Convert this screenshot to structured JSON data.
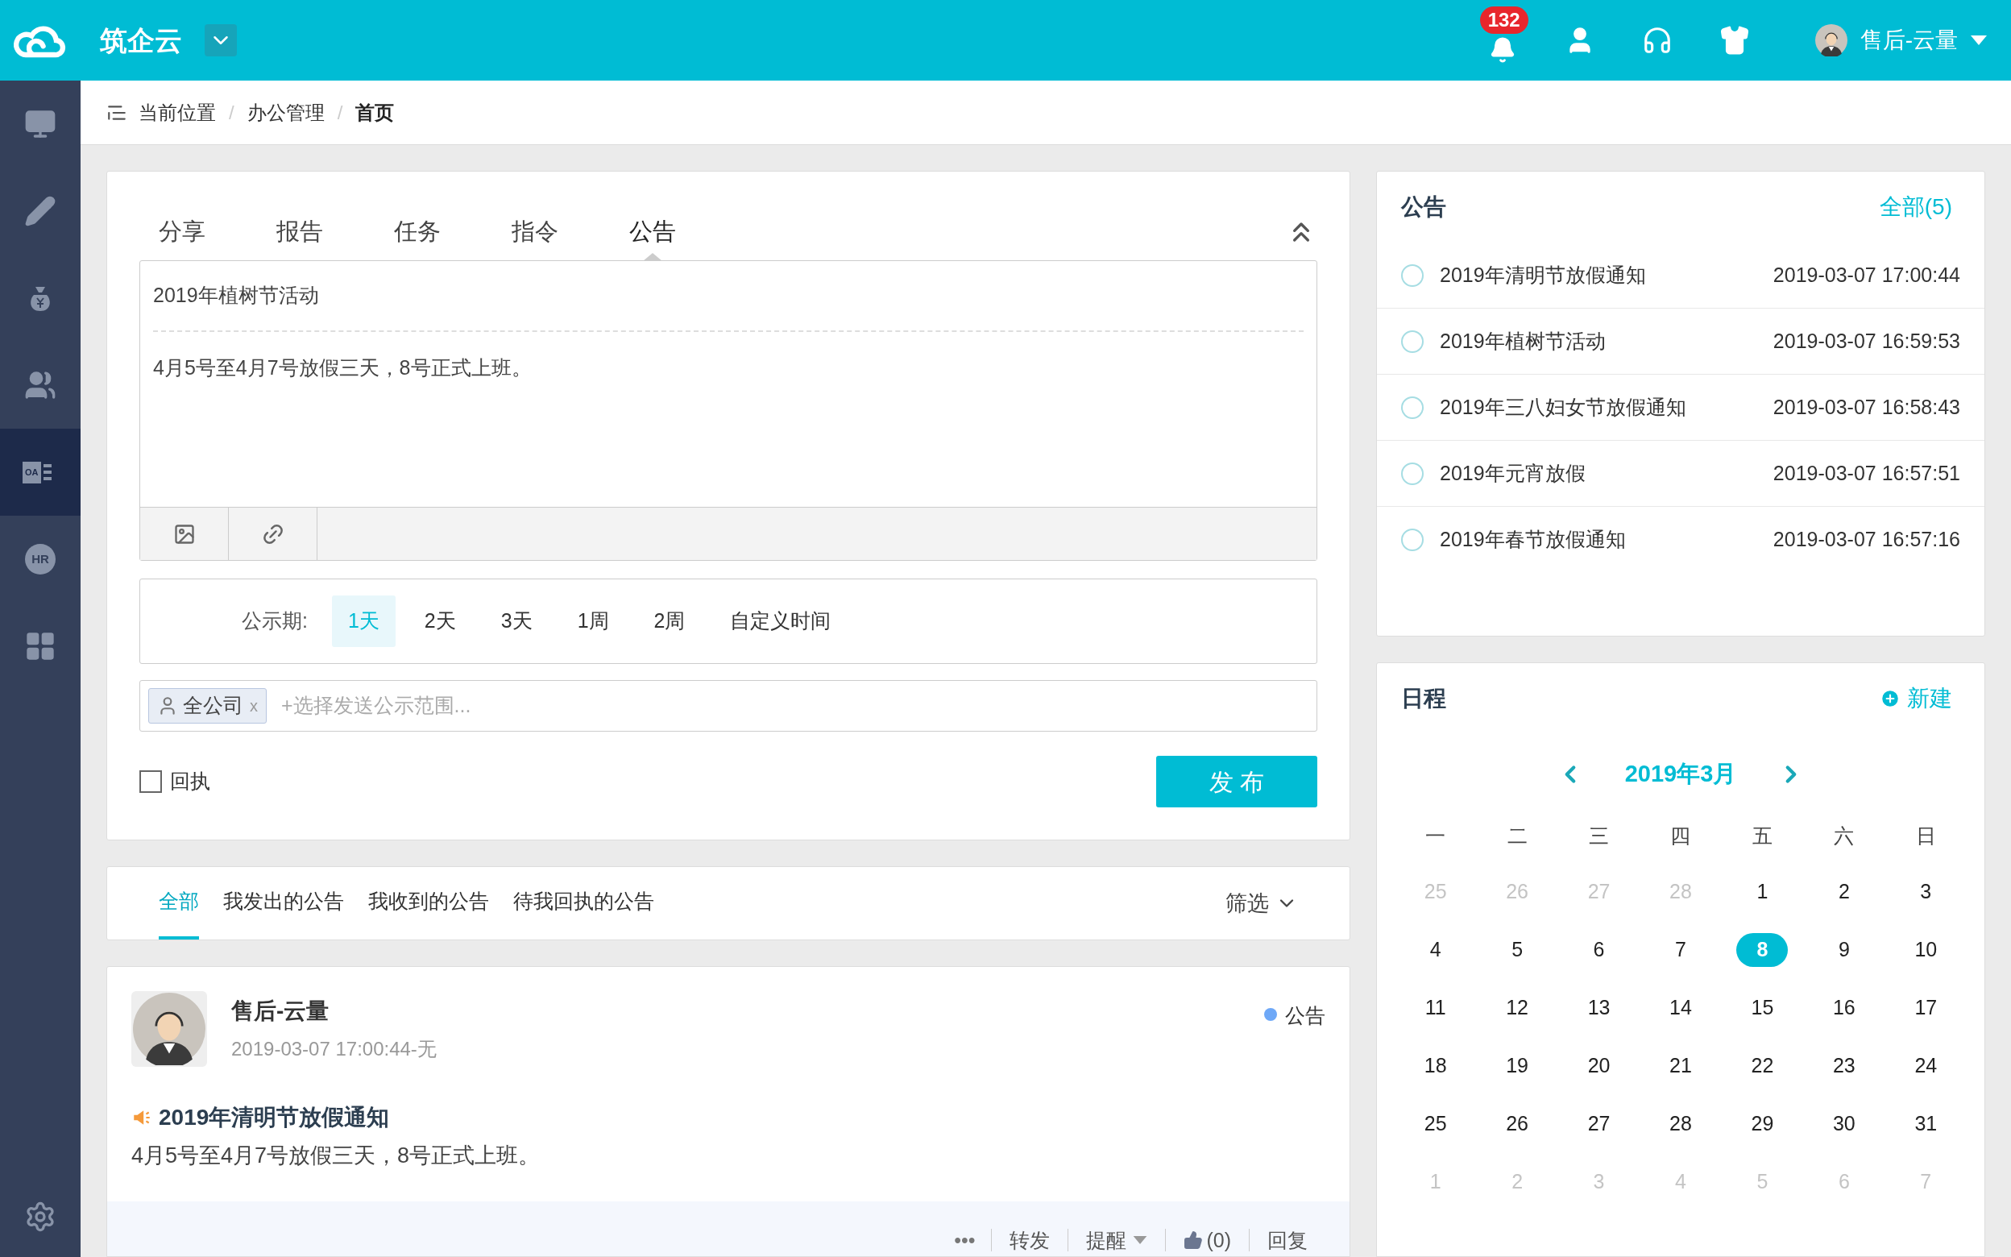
{
  "header": {
    "brand": "筑企云",
    "notifications": "132",
    "user_name": "售后-云量"
  },
  "sidebar": {
    "items": [
      {
        "kind": "monitor",
        "selected": false
      },
      {
        "kind": "pencil",
        "selected": false
      },
      {
        "kind": "money",
        "selected": false
      },
      {
        "kind": "people",
        "selected": false
      },
      {
        "kind": "oa",
        "selected": true,
        "icon_text": "OA"
      },
      {
        "kind": "hr",
        "selected": false,
        "icon_text": "HR"
      },
      {
        "kind": "grid",
        "selected": false
      }
    ]
  },
  "breadcrumb": {
    "label": "当前位置",
    "separator": "/",
    "items": [
      "办公管理",
      "首页"
    ]
  },
  "compose": {
    "tabs": [
      {
        "label": "分享",
        "selected": false
      },
      {
        "label": "报告",
        "selected": false
      },
      {
        "label": "任务",
        "selected": false
      },
      {
        "label": "指令",
        "selected": false
      },
      {
        "label": "公告",
        "selected": true
      }
    ],
    "title": "2019年植树节活动",
    "body": "4月5号至4月7号放假三天，8号正式上班。",
    "period_label": "公示期:",
    "periods": [
      {
        "label": "1天",
        "selected": true
      },
      {
        "label": "2天",
        "selected": false
      },
      {
        "label": "3天",
        "selected": false
      },
      {
        "label": "1周",
        "selected": false
      },
      {
        "label": "2周",
        "selected": false
      },
      {
        "label": "自定义时间",
        "selected": false
      }
    ],
    "scope_tag": "全公司",
    "scope_remove": "x",
    "scope_placeholder": "+选择发送公示范围...",
    "receipt": {
      "label": "回执",
      "checked": false
    },
    "publish": "发 布"
  },
  "filter": {
    "tabs": [
      {
        "label": "全部",
        "selected": true
      },
      {
        "label": "我发出的公告",
        "selected": false
      },
      {
        "label": "我收到的公告",
        "selected": false
      },
      {
        "label": "待我回执的公告",
        "selected": false
      }
    ],
    "filter_label": "筛选"
  },
  "post": {
    "author": "售后-云量",
    "meta": "2019-03-07 17:00:44-无",
    "tag": {
      "label": "公告",
      "color": "#6ea8f7"
    },
    "title": "2019年清明节放假通知",
    "body": "4月5号至4月7号放假三天，8号正式上班。",
    "actions": {
      "more": "•••",
      "forward": "转发",
      "remind": "提醒",
      "likes": "(0)",
      "reply": "回复"
    }
  },
  "notices": {
    "title": "公告",
    "all_link": "全部(5)",
    "items": [
      {
        "title": "2019年清明节放假通知",
        "time": "2019-03-07 17:00:44"
      },
      {
        "title": "2019年植树节活动",
        "time": "2019-03-07 16:59:53"
      },
      {
        "title": "2019年三八妇女节放假通知",
        "time": "2019-03-07 16:58:43"
      },
      {
        "title": "2019年元宵放假",
        "time": "2019-03-07 16:57:51"
      },
      {
        "title": "2019年春节放假通知",
        "time": "2019-03-07 16:57:16"
      }
    ]
  },
  "schedule": {
    "title": "日程",
    "new_label": "新建",
    "month": "2019年3月",
    "weekdays": [
      "一",
      "二",
      "三",
      "四",
      "五",
      "六",
      "日"
    ],
    "days": [
      {
        "label": "25",
        "in_month": false,
        "selected": false
      },
      {
        "label": "26",
        "in_month": false,
        "selected": false
      },
      {
        "label": "27",
        "in_month": false,
        "selected": false
      },
      {
        "label": "28",
        "in_month": false,
        "selected": false
      },
      {
        "label": "1",
        "in_month": true,
        "selected": false
      },
      {
        "label": "2",
        "in_month": true,
        "selected": false
      },
      {
        "label": "3",
        "in_month": true,
        "selected": false
      },
      {
        "label": "4",
        "in_month": true,
        "selected": false
      },
      {
        "label": "5",
        "in_month": true,
        "selected": false
      },
      {
        "label": "6",
        "in_month": true,
        "selected": false
      },
      {
        "label": "7",
        "in_month": true,
        "selected": false
      },
      {
        "label": "8",
        "in_month": true,
        "selected": true
      },
      {
        "label": "9",
        "in_month": true,
        "selected": false
      },
      {
        "label": "10",
        "in_month": true,
        "selected": false
      },
      {
        "label": "11",
        "in_month": true,
        "selected": false
      },
      {
        "label": "12",
        "in_month": true,
        "selected": false
      },
      {
        "label": "13",
        "in_month": true,
        "selected": false
      },
      {
        "label": "14",
        "in_month": true,
        "selected": false
      },
      {
        "label": "15",
        "in_month": true,
        "selected": false
      },
      {
        "label": "16",
        "in_month": true,
        "selected": false
      },
      {
        "label": "17",
        "in_month": true,
        "selected": false
      },
      {
        "label": "18",
        "in_month": true,
        "selected": false
      },
      {
        "label": "19",
        "in_month": true,
        "selected": false
      },
      {
        "label": "20",
        "in_month": true,
        "selected": false
      },
      {
        "label": "21",
        "in_month": true,
        "selected": false
      },
      {
        "label": "22",
        "in_month": true,
        "selected": false
      },
      {
        "label": "23",
        "in_month": true,
        "selected": false
      },
      {
        "label": "24",
        "in_month": true,
        "selected": false
      },
      {
        "label": "25",
        "in_month": true,
        "selected": false
      },
      {
        "label": "26",
        "in_month": true,
        "selected": false
      },
      {
        "label": "27",
        "in_month": true,
        "selected": false
      },
      {
        "label": "28",
        "in_month": true,
        "selected": false
      },
      {
        "label": "29",
        "in_month": true,
        "selected": false
      },
      {
        "label": "30",
        "in_month": true,
        "selected": false
      },
      {
        "label": "31",
        "in_month": true,
        "selected": false
      },
      {
        "label": "1",
        "in_month": false,
        "selected": false
      },
      {
        "label": "2",
        "in_month": false,
        "selected": false
      },
      {
        "label": "3",
        "in_month": false,
        "selected": false
      },
      {
        "label": "4",
        "in_month": false,
        "selected": false
      },
      {
        "label": "5",
        "in_month": false,
        "selected": false
      },
      {
        "label": "6",
        "in_month": false,
        "selected": false
      },
      {
        "label": "7",
        "in_month": false,
        "selected": false
      }
    ]
  }
}
